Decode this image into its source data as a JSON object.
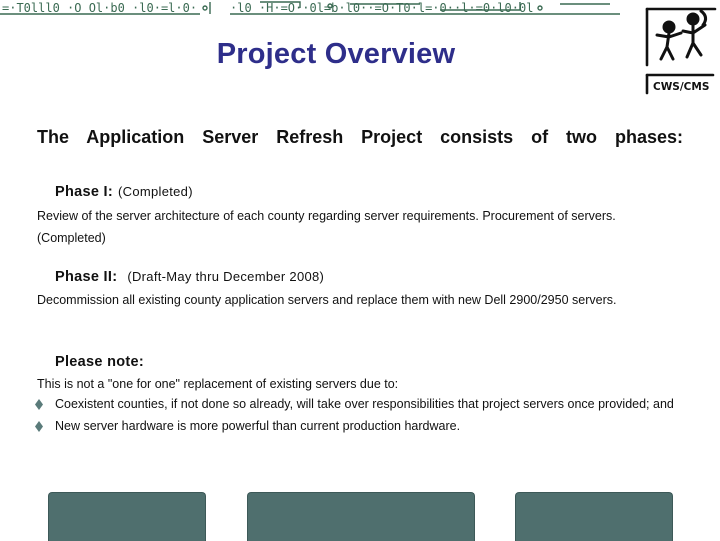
{
  "slide": {
    "title": "Project Overview",
    "intro": "The Application Server Refresh Project consists of two phases:",
    "phase1": {
      "label": "Phase I:",
      "note": "(Completed)",
      "text": "Review of the server architecture of each county regarding server requirements. Procurement of servers. (Completed)"
    },
    "phase2": {
      "label": "Phase II:",
      "note": "(Draft-May thru December 2008)",
      "text": "Decommission all existing county application servers and replace them with new Dell 2900/2950 servers."
    },
    "note": {
      "label": "Please note:",
      "text": "This is not a \"one for one\" replacement of existing servers due to:",
      "bullets": [
        "Coexistent counties, if not done so already, will take over responsibilities that project servers once provided; and",
        "New server hardware is more powerful than current production hardware."
      ]
    }
  },
  "logo": {
    "text": "CWS/CMS",
    "icon": "two-children-figures-icon"
  },
  "colors": {
    "title": "#2e2e8a",
    "footer_boxes": "#4f6f6e",
    "bullet": "#5a7b7a",
    "strip": "#3a6a52"
  }
}
